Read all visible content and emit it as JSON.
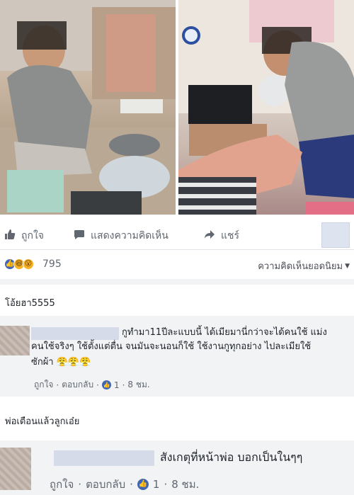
{
  "photos": {
    "left_alt": "ผู้ชายนั่งซักรองเท้าบนเก้าอี้พลาสติก",
    "right_alt": "ผู้ชายนวดเท้าให้ผู้หญิงในห้อง"
  },
  "actions": {
    "like": "ถูกใจ",
    "comment": "แสดงความคิดเห็น",
    "share": "แชร์"
  },
  "reactions": {
    "icons": [
      "like-icon",
      "haha-icon",
      "wow-icon"
    ],
    "count": "795",
    "top_comments": "ความคิดเห็นยอดนิยม"
  },
  "comments": [
    {
      "text": "โอ้ยฮา5555"
    },
    {
      "text_line1": "กูทำมา11ปีละแบบนี้ ได้เมียมานี่กว่าจะได้คนใช้ แม่ง",
      "text_line2": "คนใช้จริงๆ ใช้ตั้งแต่ตื่น จนมันจะนอนก็ใช้ ใช้งานกูทุกอย่าง ไปละเมียใช้",
      "text_line3": "ซักผ้า 😤😤😤",
      "like": "ถูกใจ",
      "reply": "ตอบกลับ",
      "likes": "1",
      "time": "8 ชม."
    },
    {
      "text": "พ่อเตือนแล้วลูกเอ๋ย"
    },
    {
      "text": "สังเกตุที่หน้าพ่อ บอกเป็นในๆๆ",
      "like": "ถูกใจ",
      "reply": "ตอบกลับ",
      "likes": "1",
      "time": "8 ชม."
    }
  ],
  "colors": {
    "fb_blue": "#4267b2",
    "meta_grey": "#606770",
    "band_grey": "#f2f3f5"
  }
}
